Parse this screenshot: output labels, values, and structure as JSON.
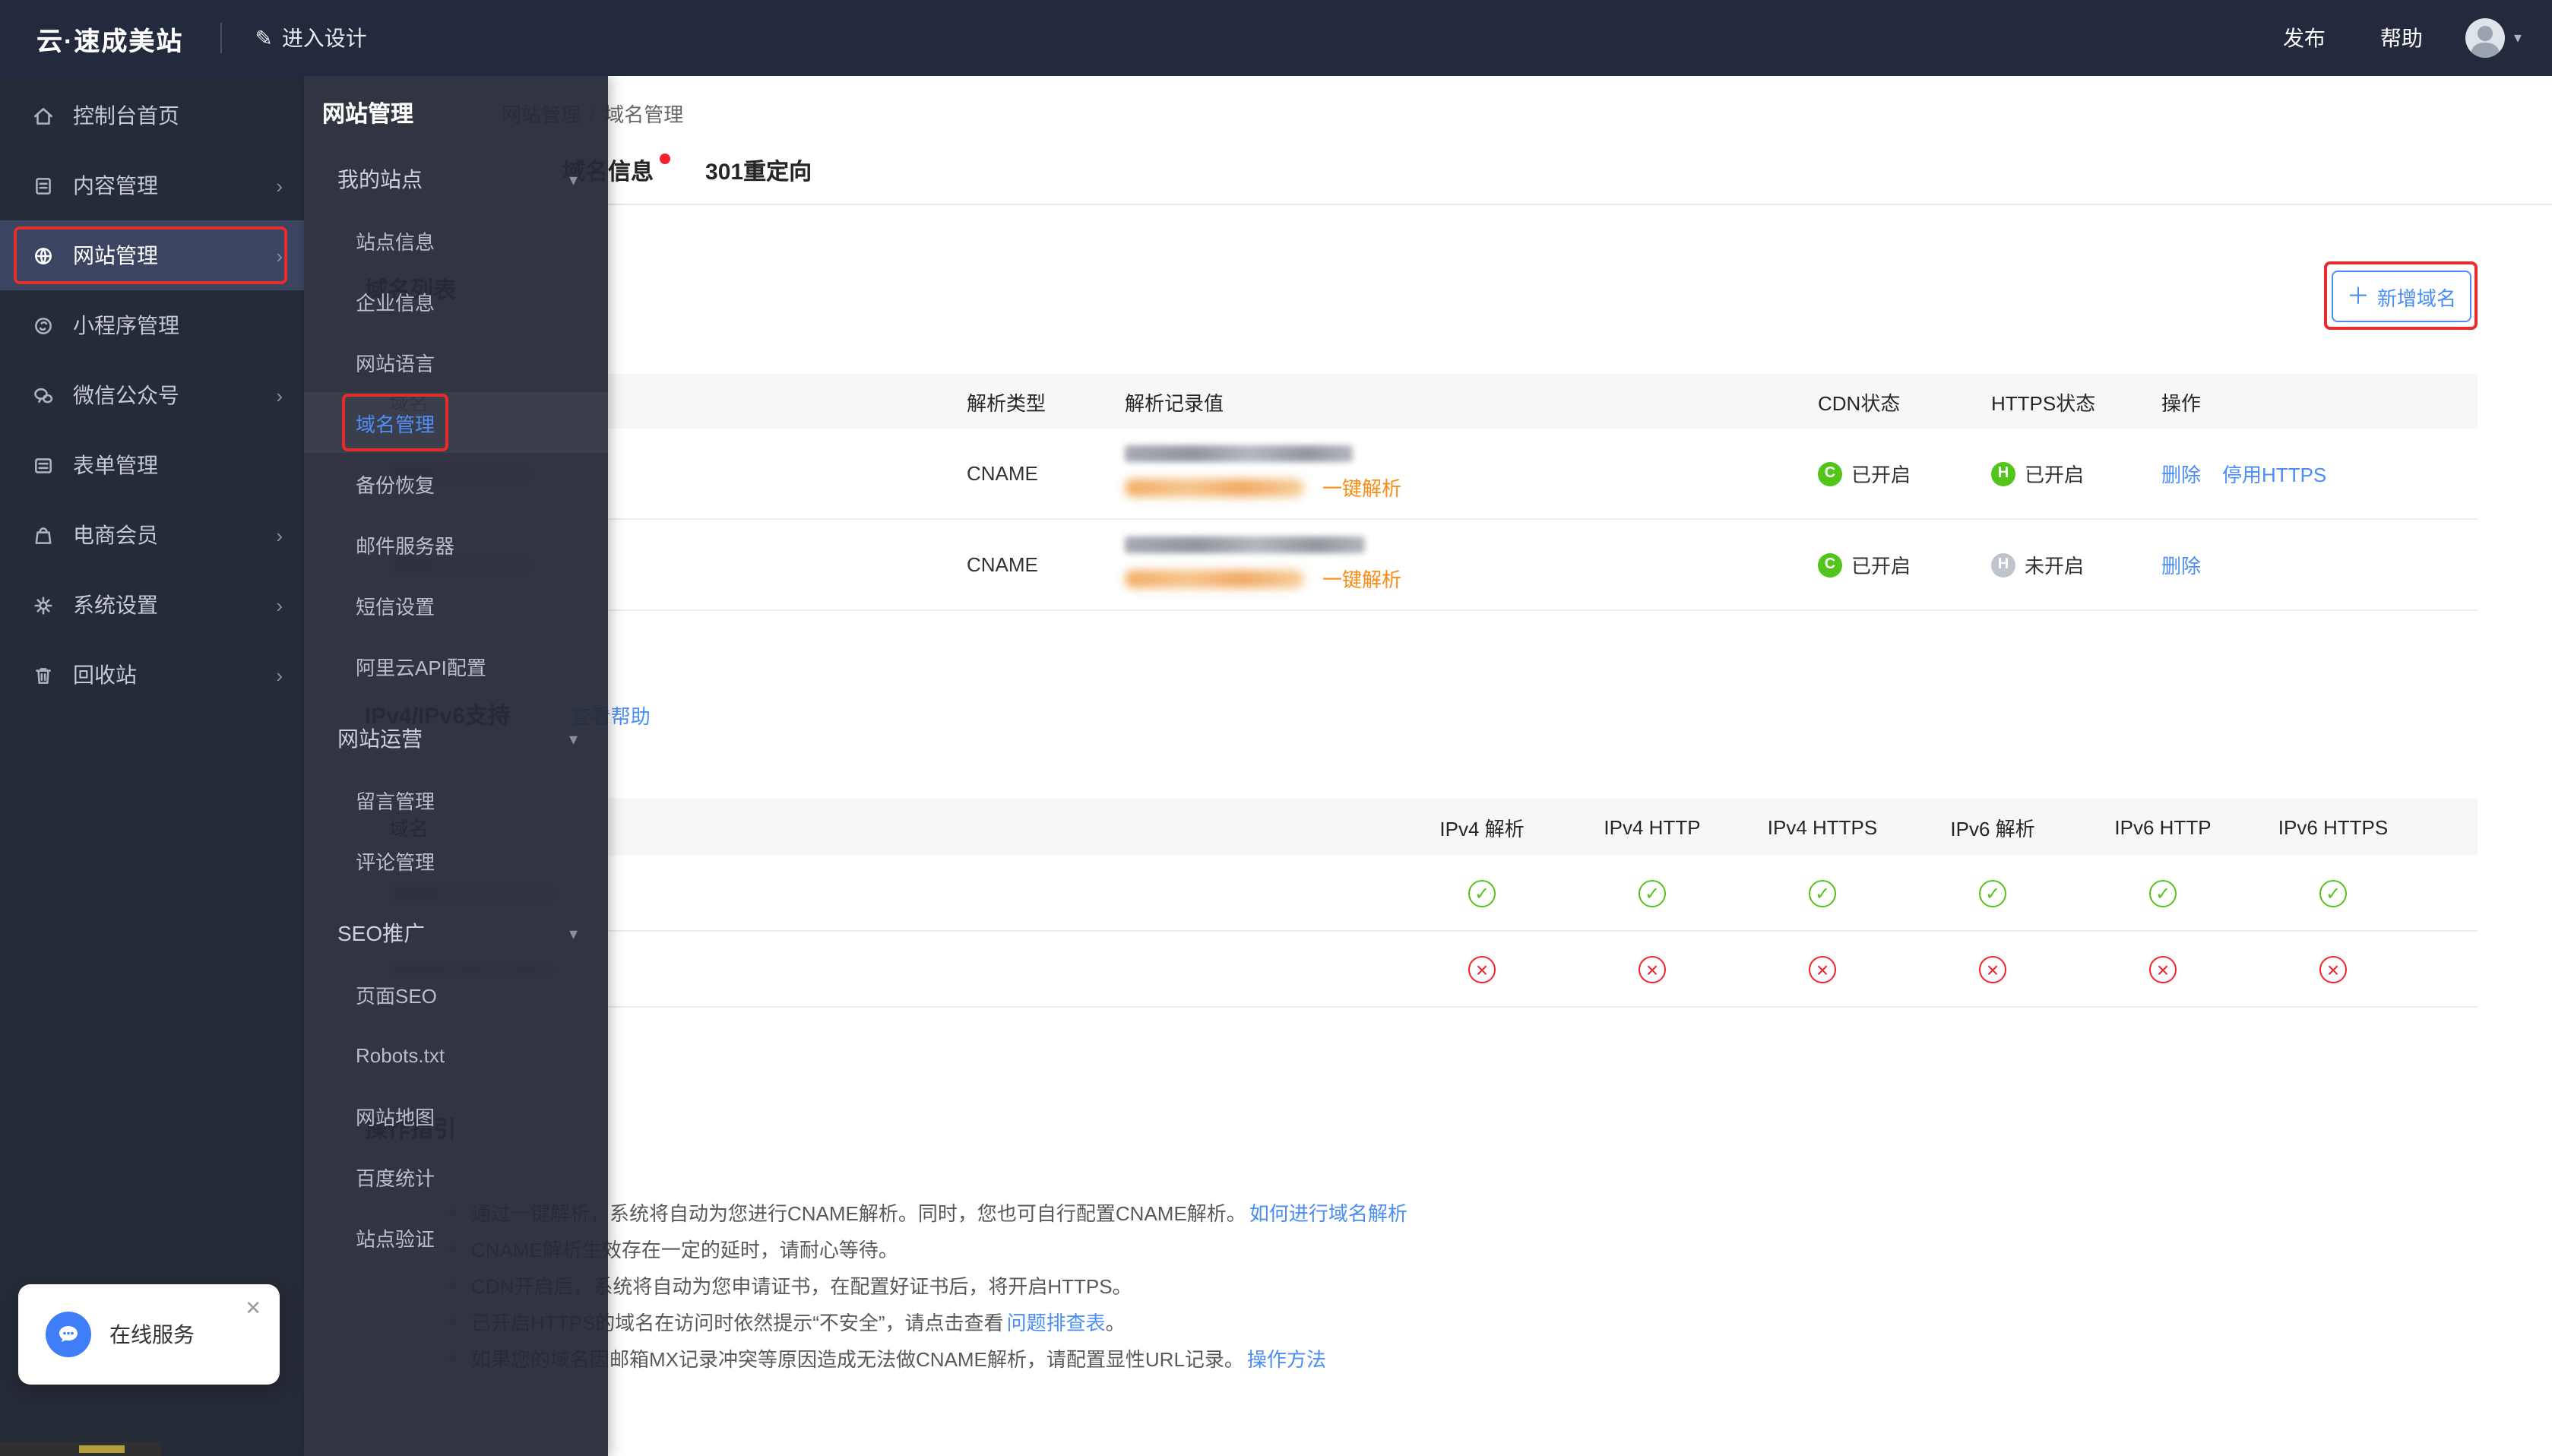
{
  "colors": {
    "topbar_bg": "#232a3d",
    "sidebar_bg": "#262b38",
    "accent_blue": "#4a8df5",
    "link_orange": "#fa8c16",
    "status_green": "#52c41a",
    "status_red": "#f5222d",
    "annotation_red": "#e82c2c"
  },
  "topbar": {
    "logo": "云·速成美站",
    "design_button": "进入设计",
    "publish": "发布",
    "help": "帮助"
  },
  "sidebar": {
    "items": [
      {
        "label": "控制台首页",
        "icon": "home-icon",
        "chevron": false,
        "active": false
      },
      {
        "label": "内容管理",
        "icon": "content-icon",
        "chevron": true,
        "active": false
      },
      {
        "label": "网站管理",
        "icon": "site-icon",
        "chevron": true,
        "active": true
      },
      {
        "label": "小程序管理",
        "icon": "miniapp-icon",
        "chevron": false,
        "active": false
      },
      {
        "label": "微信公众号",
        "icon": "wechat-icon",
        "chevron": true,
        "active": false
      },
      {
        "label": "表单管理",
        "icon": "form-icon",
        "chevron": false,
        "active": false
      },
      {
        "label": "电商会员",
        "icon": "shop-icon",
        "chevron": true,
        "active": false
      },
      {
        "label": "系统设置",
        "icon": "settings-icon",
        "chevron": true,
        "active": false
      },
      {
        "label": "回收站",
        "icon": "trash-icon",
        "chevron": true,
        "active": false
      }
    ],
    "online_service": "在线服务"
  },
  "flyout": {
    "title": "网站管理",
    "groups": [
      {
        "label": "我的站点",
        "expanded": true,
        "items": [
          "站点信息",
          "企业信息",
          "网站语言",
          "域名管理",
          "备份恢复",
          "邮件服务器",
          "短信设置",
          "阿里云API配置"
        ],
        "active_item": "域名管理"
      },
      {
        "label": "网站运营",
        "expanded": true,
        "items": [
          "留言管理",
          "评论管理"
        ]
      },
      {
        "label": "SEO推广",
        "expanded": true,
        "items": [
          "页面SEO",
          "Robots.txt",
          "网站地图",
          "百度统计",
          "站点验证"
        ]
      }
    ]
  },
  "main": {
    "breadcrumb": [
      "网站管理",
      "域名管理"
    ],
    "tabs": [
      {
        "label": "域名信息",
        "badge": true
      },
      {
        "label": "301重定向",
        "badge": false
      }
    ],
    "domain_list": {
      "section_title": "域名列表",
      "add_button": "新增域名",
      "columns": [
        "域名",
        "解析类型",
        "解析记录值",
        "CDN状态",
        "HTTPS状态",
        "操作"
      ],
      "rows": [
        {
          "type": "CNAME",
          "value_redacted": true,
          "resolve_link": "一键解析",
          "cdn": "已开启",
          "cdn_on": true,
          "https": "已开启",
          "https_on": true,
          "actions": [
            "删除",
            "停用HTTPS"
          ]
        },
        {
          "type": "CNAME",
          "value_redacted": true,
          "resolve_link": "一键解析",
          "cdn": "已开启",
          "cdn_on": true,
          "https": "未开启",
          "https_on": false,
          "actions": [
            "删除"
          ]
        }
      ]
    },
    "ip_support": {
      "section_title": "IPv4/IPv6支持",
      "help_link": "查看帮助",
      "columns": [
        "域名",
        "IPv4 解析",
        "IPv4 HTTP",
        "IPv4 HTTPS",
        "IPv6 解析",
        "IPv6 HTTP",
        "IPv6 HTTPS"
      ],
      "rows": [
        {
          "domain_redacted": true,
          "status": "pass"
        },
        {
          "domain_redacted": true,
          "status": "fail"
        }
      ]
    },
    "guide": {
      "section_title": "操作指引",
      "bullets": [
        {
          "text": "通过一键解析，系统将自动为您进行CNAME解析。同时，您也可自行配置CNAME解析。",
          "link": "如何进行域名解析",
          "suffix": ""
        },
        {
          "text": "CNAME解析生效存在一定的延时，请耐心等待。",
          "link": "",
          "suffix": ""
        },
        {
          "text": "CDN开启后，系统将自动为您申请证书，在配置好证书后，将开启HTTPS。",
          "link": "",
          "suffix": ""
        },
        {
          "text": "已开启HTTPS的域名在访问时依然提示“不安全”，请点击查看",
          "link": "问题排查表",
          "suffix": "。"
        },
        {
          "text": "如果您的域名因邮箱MX记录冲突等原因造成无法做CNAME解析，请配置显性URL记录。",
          "link": "操作方法",
          "suffix": ""
        }
      ]
    }
  }
}
